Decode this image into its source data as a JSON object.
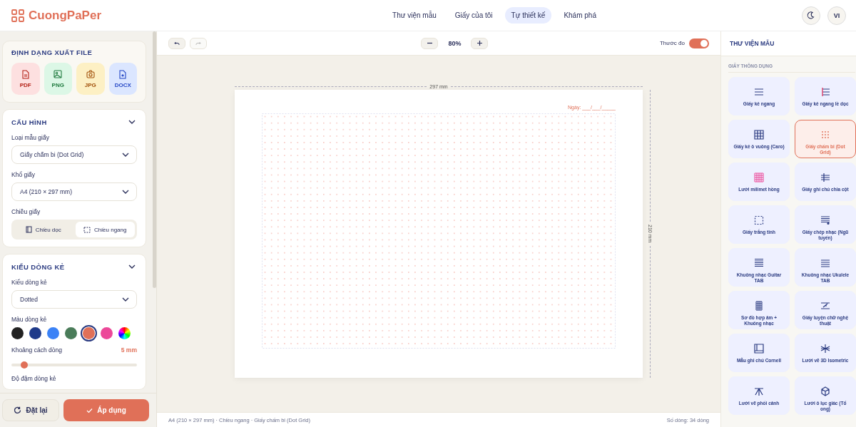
{
  "header": {
    "logo": "CuongPaPer",
    "nav": [
      {
        "label": "Thư viện mẫu",
        "selected": false
      },
      {
        "label": "Giấy của tôi",
        "selected": false
      },
      {
        "label": "Tự thiết kế",
        "selected": true
      },
      {
        "label": "Khám phá",
        "selected": false
      }
    ],
    "language": "VI"
  },
  "export": {
    "title": "ĐỊNH DẠNG XUẤT FILE",
    "formats": [
      {
        "label": "PDF",
        "kind": "pdf"
      },
      {
        "label": "PNG",
        "kind": "png"
      },
      {
        "label": "JPG",
        "kind": "jpg"
      },
      {
        "label": "DOCX",
        "kind": "docx"
      }
    ]
  },
  "config": {
    "title": "CẤU HÌNH",
    "expanded": true,
    "paper_type_label": "Loại mẫu giấy",
    "paper_type": "Giấy chấm bi (Dot Grid)",
    "size_label": "Khổ giấy",
    "size": "A4 (210 × 297 mm)",
    "orientation_label": "Chiều giấy",
    "orientations": [
      {
        "label": "Chiều dọc",
        "kind": "portrait",
        "selected": false
      },
      {
        "label": "Chiều ngang",
        "kind": "landscape",
        "selected": true
      }
    ]
  },
  "line_style": {
    "title": "KIỂU DÒNG KẺ",
    "expanded": true,
    "style_label": "Kiểu dòng kẻ",
    "style": "Dotted",
    "color_label": "Màu dòng kẻ",
    "colors": [
      {
        "color": "#222222",
        "selected": false
      },
      {
        "color": "#1e3a8a",
        "selected": false
      },
      {
        "color": "#3b82f6",
        "selected": false
      },
      {
        "color": "#4a7c59",
        "selected": false
      },
      {
        "color": "#e07058",
        "selected": true
      },
      {
        "color": "#ec4899",
        "selected": false
      },
      {
        "kind": "rainbow",
        "selected": false
      }
    ],
    "spacing_label": "Khoảng cách dòng",
    "spacing": "5 mm",
    "spacing_level": {
      "level": 0.1
    },
    "weight_label": "Độ đậm dòng kẻ"
  },
  "actions": [
    {
      "label": "Đặt lại",
      "kind": "reset"
    },
    {
      "label": "Áp dụng",
      "kind": "apply"
    }
  ],
  "toolbar": {
    "zoom": "80%",
    "ruler_label": "Thước đo",
    "ruler_on": true
  },
  "canvas": {
    "width_label": "297 mm",
    "height_label": "210 mm",
    "date_label": "Ngày: ___/___/_____"
  },
  "status_bar": {
    "summary": "A4 (210 × 297 mm) · Chiều ngang · Giấy chấm bi (Dot Grid)",
    "line_count": "Số dòng: 34 dòng"
  },
  "library": {
    "title": "THƯ VIỆN MẪU",
    "section": "GIẤY THÔNG DỤNG",
    "templates": [
      {
        "label": "Giấy kẻ ngang",
        "kind": "lines",
        "selected": false
      },
      {
        "label": "Giấy kẻ ngang lề dọc",
        "kind": "margin",
        "selected": false
      },
      {
        "label": "Giấy kẻ ô vuông (Caro)",
        "kind": "grid",
        "selected": false
      },
      {
        "label": "Giấy chấm bi (Dot Grid)",
        "kind": "dots",
        "selected": true
      },
      {
        "label": "Lưới milimet hồng",
        "kind": "mm",
        "selected": false
      },
      {
        "label": "Giấy ghi chú chia cột",
        "kind": "cue",
        "selected": false
      },
      {
        "label": "Giấy trắng tinh",
        "kind": "blank",
        "selected": false
      },
      {
        "label": "Giấy chép nhạc (Ngũ tuyến)",
        "kind": "music",
        "selected": false
      },
      {
        "label": "Khuông nhạc Guitar TAB",
        "kind": "guitar",
        "selected": false
      },
      {
        "label": "Khuông nhạc Ukulele TAB",
        "kind": "ukulele",
        "selected": false
      },
      {
        "label": "Sơ đồ hợp âm + Khuông nhạc",
        "kind": "chord",
        "selected": false
      },
      {
        "label": "Giấy luyện chữ nghệ thuật",
        "kind": "calligraphy",
        "selected": false
      },
      {
        "label": "Mẫu ghi chú Cornell",
        "kind": "cornell",
        "selected": false
      },
      {
        "label": "Lưới vẽ 3D Isometric",
        "kind": "iso",
        "selected": false
      },
      {
        "label": "Lưới vẽ phối cảnh",
        "kind": "perspective",
        "selected": false
      },
      {
        "label": "Lưới ô lục giác (Tổ ong)",
        "kind": "hex",
        "selected": false
      }
    ]
  }
}
